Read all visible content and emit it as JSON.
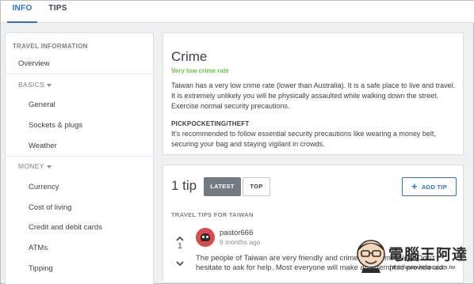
{
  "tabs": [
    {
      "label": "INFO",
      "active": true
    },
    {
      "label": "TIPS",
      "active": false
    }
  ],
  "sidebar": {
    "heading": "TRAVEL INFORMATION",
    "overview": "Overview",
    "basics_label": "BASICS",
    "basics_items": [
      "General",
      "Sockets & plugs",
      "Weather"
    ],
    "money_label": "MONEY",
    "money_items": [
      "Currency",
      "Cost of living",
      "Credit and debit cards",
      "ATMs",
      "Tipping"
    ]
  },
  "crime": {
    "title": "Crime",
    "rating": "Very low crime rate",
    "rating_color": "#6cc04a",
    "description": "Taiwan has a very low crime rate (lower than Australia). It is a safe place to live and travel. It is extremely unlikely you will be physically assaulted while walking down the street. Exercise normal security precautions.",
    "subheading": "PICKPOCKETING/THEFT",
    "subdescription": "It's recommended to follow essential security precautions like wearing a money belt, securing your bag and staying vigilant in crowds."
  },
  "tips": {
    "count_label": "1 tip",
    "latest_label": "LATEST",
    "top_label": "TOP",
    "add_label": "ADD TIP",
    "add_icon": "plus-icon",
    "heading": "TRAVEL TIPS FOR TAIWAN",
    "items": [
      {
        "votes": "1",
        "user": "pastor666",
        "time": "9 months ago",
        "text": "The people of Taiwan are very friendly and crime is extremely low. Don't hesitate to ask for help. Most everyone will make an attempt to provide aid."
      }
    ]
  },
  "watermark": {
    "brand": "電腦王阿達",
    "url": "http://www.kocpc.com.tw"
  },
  "colors": {
    "accent": "#2c6fd1",
    "latest_bg": "#737a82",
    "avatar_bg": "#d94b4f"
  }
}
